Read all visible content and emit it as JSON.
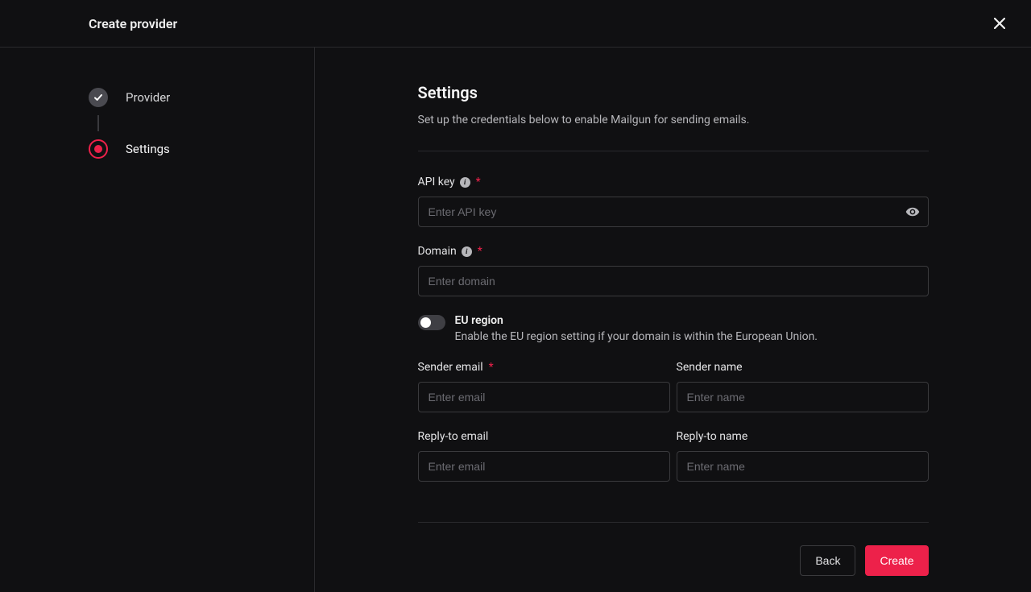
{
  "header": {
    "title": "Create provider"
  },
  "sidebar": {
    "steps": [
      {
        "label": "Provider"
      },
      {
        "label": "Settings"
      }
    ]
  },
  "main": {
    "title": "Settings",
    "description": "Set up the credentials below to enable Mailgun for sending emails.",
    "fields": {
      "api_key": {
        "label": "API key",
        "placeholder": "Enter API key"
      },
      "domain": {
        "label": "Domain",
        "placeholder": "Enter domain"
      },
      "eu_region": {
        "title": "EU region",
        "description": "Enable the EU region setting if your domain is within the European Union."
      },
      "sender_email": {
        "label": "Sender email",
        "placeholder": "Enter email"
      },
      "sender_name": {
        "label": "Sender name",
        "placeholder": "Enter name"
      },
      "reply_email": {
        "label": "Reply-to email",
        "placeholder": "Enter email"
      },
      "reply_name": {
        "label": "Reply-to name",
        "placeholder": "Enter name"
      }
    },
    "buttons": {
      "back": "Back",
      "create": "Create"
    }
  }
}
